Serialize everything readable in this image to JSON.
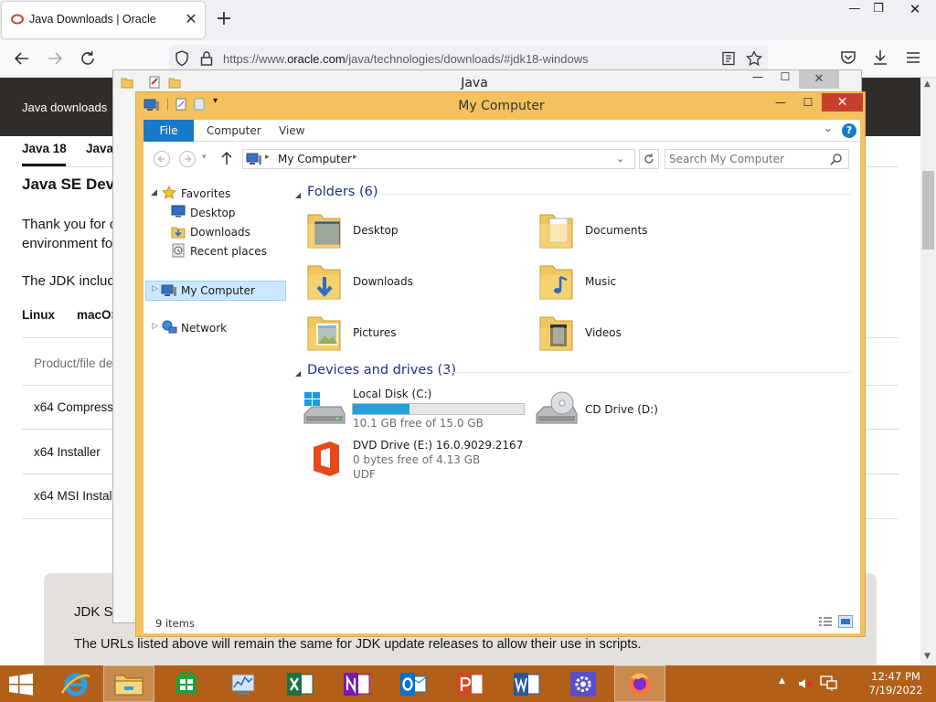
{
  "browser": {
    "tab_title": "Java Downloads | Oracle",
    "url_prefix": "https://www.",
    "url_host": "oracle.com",
    "url_path": "/java/technologies/downloads/#jdk18-windows"
  },
  "page": {
    "topbar_label": "Java downloads",
    "tabs": [
      "Java 18",
      "Java"
    ],
    "heading": "Java SE Deve",
    "intro_line1": "Thank you for c",
    "intro_line2": "environment fo",
    "jdk_line": "The JDK incluc",
    "os_tabs": [
      "Linux",
      "macOS"
    ],
    "table_header": "Product/file de",
    "rows": [
      "x64 Compresse",
      "x64 Installer",
      "x64 MSI Install"
    ],
    "banner_title": "JDK Scr",
    "banner_text": "The URLs listed above will remain the same for JDK update releases to allow their use in scripts."
  },
  "java_window": {
    "title": "Java"
  },
  "explorer": {
    "title": "My Computer",
    "ribbon_tabs": {
      "file": "File",
      "computer": "Computer",
      "view": "View"
    },
    "address": "My Computer",
    "search_placeholder": "Search My Computer",
    "nav": {
      "favorites": "Favorites",
      "desktop": "Desktop",
      "downloads": "Downloads",
      "recent": "Recent places",
      "my_computer": "My Computer",
      "network": "Network"
    },
    "folders_header": "Folders (6)",
    "folders": [
      "Desktop",
      "Documents",
      "Downloads",
      "Music",
      "Pictures",
      "Videos"
    ],
    "devices_header": "Devices and drives (3)",
    "drives": {
      "c_name": "Local Disk (C:)",
      "c_free": "10.1 GB free of 15.0 GB",
      "c_used_fraction": 0.33,
      "d_name": "CD Drive (D:)",
      "e_name": "DVD Drive (E:) 16.0.9029.2167",
      "e_free": "0 bytes free of 4.13 GB",
      "e_fs": "UDF"
    },
    "status": "9 items"
  },
  "taskbar": {
    "time": "12:47 PM",
    "date": "7/19/2022"
  },
  "colors": {
    "explorer_frame": "#f3c25f",
    "taskbar": "#b25f19",
    "file_tab": "#1979ca",
    "close_button": "#c7402c",
    "oracle_topbar": "#312d2a"
  }
}
